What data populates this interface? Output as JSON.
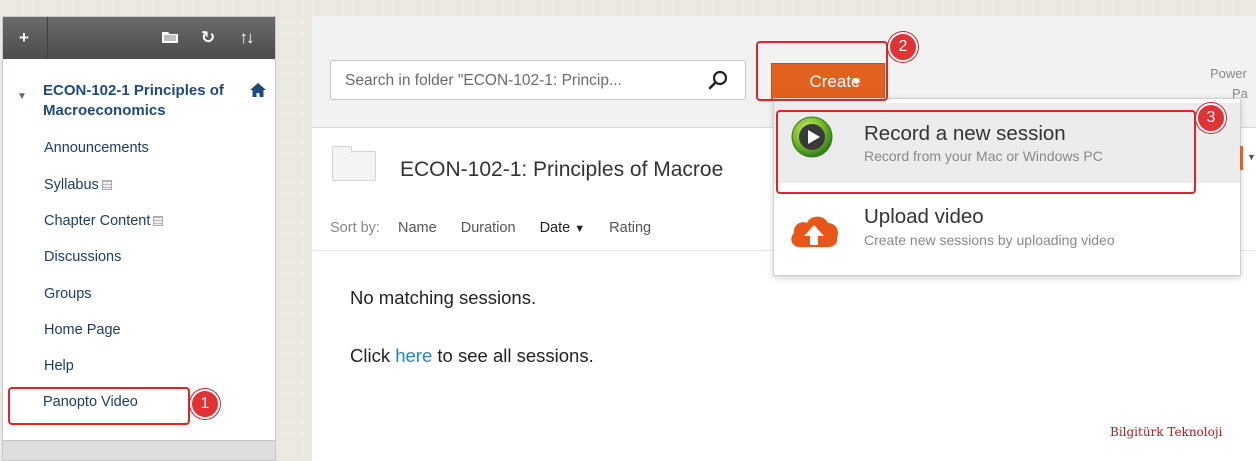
{
  "sidebar": {
    "toolbar": {
      "add_icon": "plus-icon",
      "folder_icon": "folder-icon",
      "refresh_icon": "refresh-icon",
      "sort_icon": "sort-arrows-icon"
    },
    "course_title": "ECON-102-1 Principles of Macroeconomics",
    "items": [
      {
        "label": "Announcements",
        "has_doc_icon": false
      },
      {
        "label": "Syllabus",
        "has_doc_icon": true
      },
      {
        "label": "Chapter Content",
        "has_doc_icon": true
      },
      {
        "label": "Discussions",
        "has_doc_icon": false
      },
      {
        "label": "Groups",
        "has_doc_icon": false
      },
      {
        "label": "Home Page",
        "has_doc_icon": false
      },
      {
        "label": "Help",
        "has_doc_icon": false
      },
      {
        "label": "Panopto Video",
        "has_doc_icon": false
      }
    ]
  },
  "main": {
    "search": {
      "placeholder": "Search in folder \"ECON-102-1: Princip...",
      "value": ""
    },
    "create_label": "Create",
    "powered_line1": "Power",
    "powered_line2": "Pa",
    "folder_title": "ECON-102-1: Principles of Macroe",
    "sort": {
      "label": "Sort by:",
      "options": [
        "Name",
        "Duration",
        "Date",
        "Rating"
      ],
      "active": "Date",
      "active_indicator": "▼"
    },
    "empty_message": "No matching sessions.",
    "see_all_prefix": "Click",
    "see_all_link": "here",
    "see_all_suffix": "to see all sessions."
  },
  "create_menu": {
    "items": [
      {
        "title": "Record a new session",
        "subtitle": "Record from your Mac or Windows PC",
        "icon": "record-play-icon"
      },
      {
        "title": "Upload video",
        "subtitle": "Create new sessions by uploading video",
        "icon": "cloud-upload-icon"
      }
    ]
  },
  "annotations": {
    "badges": [
      "1",
      "2",
      "3"
    ],
    "highlight_color": "#e0242b"
  },
  "watermark": "Bilgitürk Teknoloji",
  "colors": {
    "accent_orange": "#e2611e",
    "link_blue": "#2a82c6",
    "course_blue": "#1f4a7a",
    "badge_red": "#e13236"
  }
}
